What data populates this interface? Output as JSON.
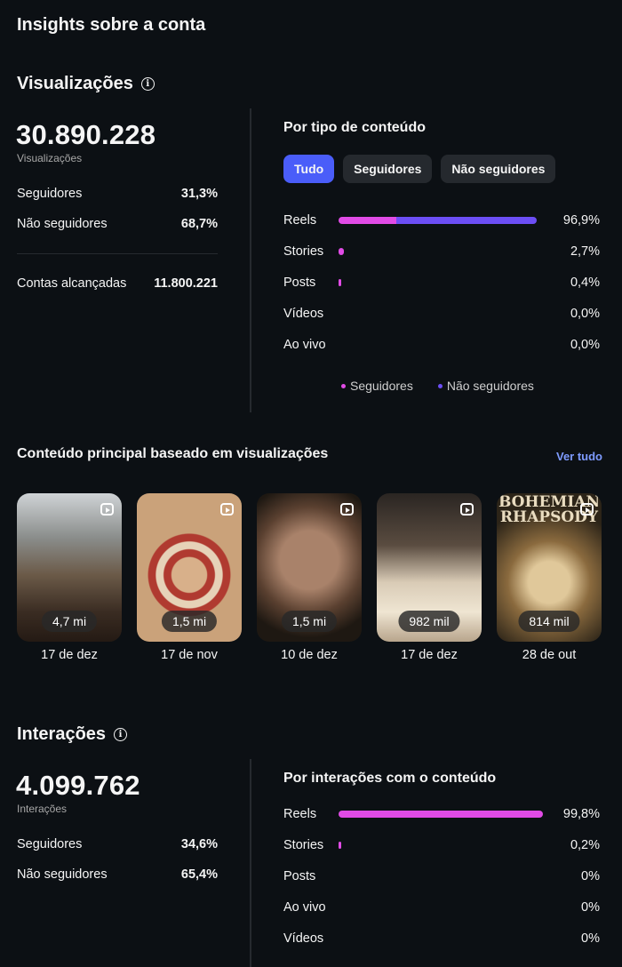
{
  "page_title": "Insights sobre a conta",
  "views_section": {
    "title": "Visualizações",
    "total": "30.890.228",
    "total_label": "Visualizações",
    "rows": [
      {
        "label": "Seguidores",
        "value": "31,3%"
      },
      {
        "label": "Não seguidores",
        "value": "68,7%"
      }
    ],
    "reach_label": "Contas alcançadas",
    "reach_value": "11.800.221",
    "by_type_title": "Por tipo de conteúdo",
    "filters": [
      "Tudo",
      "Seguidores",
      "Não seguidores"
    ],
    "active_filter": "Tudo",
    "breakdown": [
      {
        "label": "Reels",
        "value": "96,9%",
        "followers": 0.291,
        "non_followers": 0.709,
        "total": 0.969
      },
      {
        "label": "Stories",
        "value": "2,7%",
        "followers": 1.0,
        "non_followers": 0.0,
        "total": 0.027
      },
      {
        "label": "Posts",
        "value": "0,4%",
        "followers": 1.0,
        "non_followers": 0.0,
        "total": 0.004
      },
      {
        "label": "Vídeos",
        "value": "0,0%",
        "followers": 0,
        "non_followers": 0,
        "total": 0
      },
      {
        "label": "Ao vivo",
        "value": "0,0%",
        "followers": 0,
        "non_followers": 0,
        "total": 0
      }
    ],
    "legend": [
      {
        "label": "Seguidores",
        "color": "#e14be6"
      },
      {
        "label": "Não seguidores",
        "color": "#6c4ef5"
      }
    ]
  },
  "top_content": {
    "title": "Conteúdo principal baseado em visualizações",
    "see_all": "Ver tudo",
    "items": [
      {
        "views": "4,7 mi",
        "date": "17 de dez",
        "icon": "reel-icon"
      },
      {
        "views": "1,5 mi",
        "date": "17 de nov",
        "icon": "reel-icon"
      },
      {
        "views": "1,5 mi",
        "date": "10 de dez",
        "icon": "reel-icon"
      },
      {
        "views": "982 mil",
        "date": "17 de dez",
        "icon": "reel-icon"
      },
      {
        "views": "814 mil",
        "date": "28 de out",
        "icon": "reel-icon",
        "poster_text": "BOHEMIAN RHAPSODY"
      }
    ]
  },
  "interactions_section": {
    "title": "Interações",
    "total": "4.099.762",
    "total_label": "Interações",
    "rows": [
      {
        "label": "Seguidores",
        "value": "34,6%"
      },
      {
        "label": "Não seguidores",
        "value": "65,4%"
      }
    ],
    "by_interaction_title": "Por interações com o conteúdo",
    "breakdown": [
      {
        "label": "Reels",
        "value": "99,8%",
        "followers": 1.0,
        "non_followers": 0.0,
        "total": 0.998
      },
      {
        "label": "Stories",
        "value": "0,2%",
        "followers": 1.0,
        "non_followers": 0.0,
        "total": 0.002
      },
      {
        "label": "Posts",
        "value": "0%",
        "followers": 0,
        "non_followers": 0,
        "total": 0
      },
      {
        "label": "Ao vivo",
        "value": "0%",
        "followers": 0,
        "non_followers": 0,
        "total": 0
      },
      {
        "label": "Vídeos",
        "value": "0%",
        "followers": 0,
        "non_followers": 0,
        "total": 0
      }
    ]
  }
}
